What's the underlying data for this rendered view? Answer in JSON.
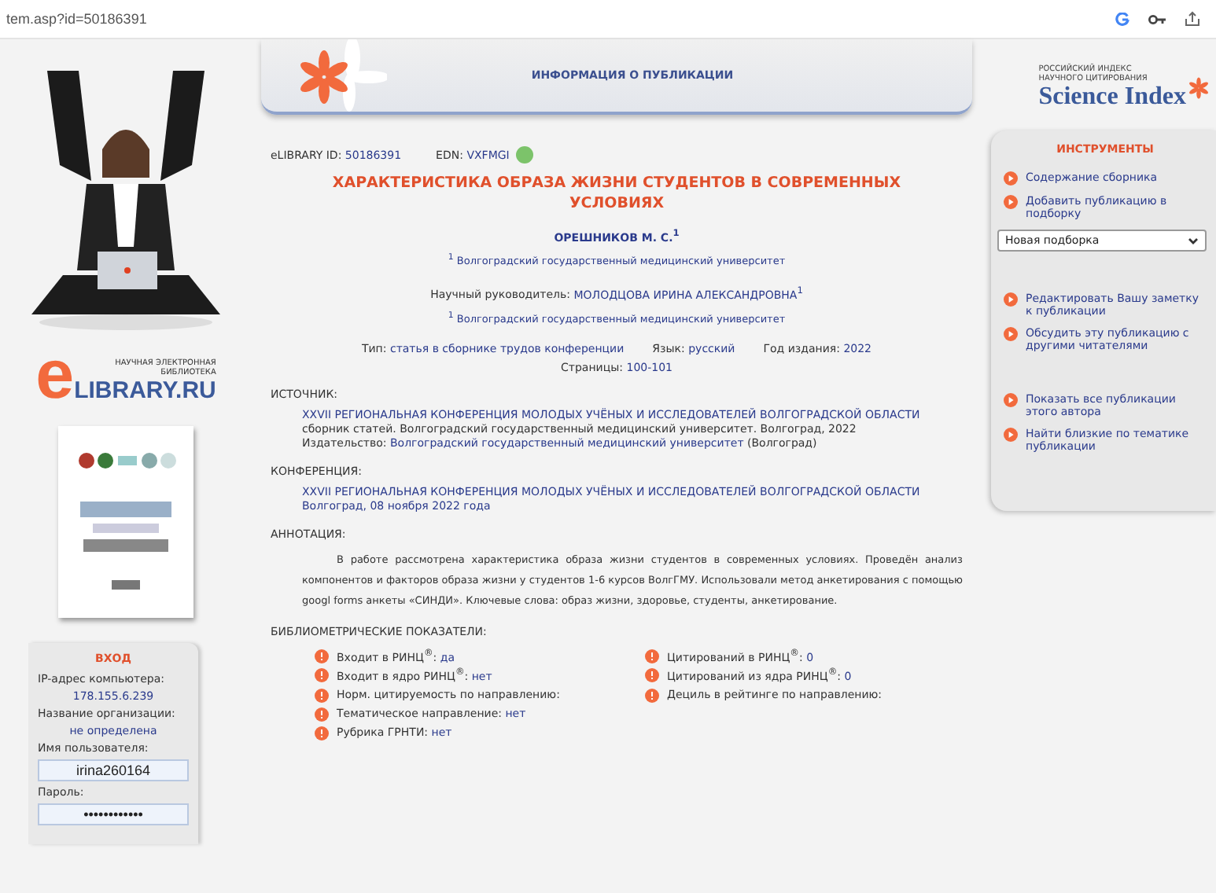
{
  "address_bar": {
    "url": "tem.asp?id=50186391"
  },
  "header": {
    "title": "ИНФОРМАЦИЯ О ПУБЛИКАЦИИ"
  },
  "brand": {
    "line_1": "РОССИЙСКИЙ ИНДЕКС",
    "line_2": "НАУЧНОГО ЦИТИРОВАНИЯ",
    "name": "Science Index"
  },
  "library_logo": {
    "letter": "e",
    "line_1": "НАУЧНАЯ ЭЛЕКТРОННАЯ",
    "line_2": "БИБЛИОТЕКА",
    "name": "LIBRARY.RU"
  },
  "login": {
    "title": "ВХОД",
    "ip_label": "IP-адрес компьютера:",
    "ip": "178.155.6.239",
    "org_label": "Название организации:",
    "org": "не определена",
    "username_label": "Имя пользователя:",
    "username": "irina260164",
    "password_label": "Пароль:",
    "password": "••••••••••••"
  },
  "tools": {
    "title": "ИНСТРУМЕНТЫ",
    "items": [
      {
        "kind": "link",
        "label": "Содержание сборника"
      },
      {
        "kind": "link",
        "label": "Добавить публикацию в подборку"
      },
      {
        "kind": "select",
        "label": "Новая подборка"
      },
      {
        "kind": "gap"
      },
      {
        "kind": "link",
        "label": "Редактировать Вашу заметку к публикации"
      },
      {
        "kind": "link",
        "label": "Обсудить эту публикацию с другими читателями"
      },
      {
        "kind": "gap"
      },
      {
        "kind": "link",
        "label": "Показать все публикации этого автора"
      },
      {
        "kind": "link",
        "label": "Найти близкие по тематике публикации"
      }
    ]
  },
  "publication": {
    "id_label": "eLIBRARY ID:",
    "id": "50186391",
    "edn_label": "EDN:",
    "edn": "VXFMGI",
    "title": "ХАРАКТЕРИСТИКА ОБРАЗА ЖИЗНИ СТУДЕНТОВ В СОВРЕМЕННЫХ УСЛОВИЯХ",
    "author": "ОРЕШНИКОВ М. С.$^{1}$",
    "affiliation": "$^{1}$ Волгоградский государственный медицинский университет",
    "supervisor_label": "Научный руководитель:",
    "supervisor": "МОЛОДЦОВА ИРИНА АЛЕКСАНДРОВНА$^{1}$",
    "supervisor_affiliation": "$^{1}$ Волгоградский государственный медицинский университет",
    "meta": [
      {
        "label": "Тип:",
        "value": "статья в сборнике трудов конференции"
      },
      {
        "label": "Язык:",
        "value": "русский"
      },
      {
        "label": "Год издания:",
        "value": "2022"
      }
    ],
    "pages_label": "Страницы:",
    "pages": "100-101"
  },
  "source": {
    "heading": "ИСТОЧНИК:",
    "title": "XXVII РЕГИОНАЛЬНАЯ КОНФЕРЕНЦИЯ МОЛОДЫХ УЧЁНЫХ И ИССЛЕДОВАТЕЛЕЙ ВОЛГОГРАДСКОЙ ОБЛАСТИ",
    "details": "сборник статей. Волгоградский государственный медицинский университет. Волгоград, 2022",
    "publisher_label": "Издательство:",
    "publisher": "Волгоградский государственный медицинский университет",
    "publisher_city": "(Волгоград)"
  },
  "conference": {
    "heading": "КОНФЕРЕНЦИЯ:",
    "title": "XXVII РЕГИОНАЛЬНАЯ КОНФЕРЕНЦИЯ МОЛОДЫХ УЧЁНЫХ И ИССЛЕДОВАТЕЛЕЙ ВОЛГОГРАДСКОЙ ОБЛАСТИ",
    "place_date": "Волгоград, 08 ноября 2022 года"
  },
  "annotation": {
    "heading": "АННОТАЦИЯ:",
    "text": "В работе рассмотрена характеристика образа жизни студентов в современных условиях. Проведён анализ компонентов и факторов образа жизни у студентов 1-6 курсов ВолгГМУ. Использовали метод анкетирования с помощью googl forms анкеты «СИНДИ». Ключевые слова: образ жизни, здоровье, студенты, анкетирование."
  },
  "metrics": {
    "heading": "БИБЛИОМЕТРИЧЕСКИЕ ПОКАЗАТЕЛИ:",
    "columns": [
      [
        {
          "label": "Входит в РИНЦ$^{®}$:",
          "value": "да"
        },
        {
          "label": "Входит в ядро РИНЦ$^{®}$:",
          "value": "нет"
        },
        {
          "label": "Норм. цитируемость по направлению:"
        },
        {
          "label": "Тематическое направление:",
          "value": "нет"
        },
        {
          "label": "Рубрика ГРНТИ:",
          "value": "нет"
        }
      ],
      [
        {
          "label": "Цитирований в РИНЦ$^{®}$:",
          "value": "0"
        },
        {
          "label": "Цитирований из ядра РИНЦ$^{®}$:",
          "value": "0"
        },
        {
          "label": "Дециль в рейтинге по направлению:"
        }
      ]
    ]
  }
}
